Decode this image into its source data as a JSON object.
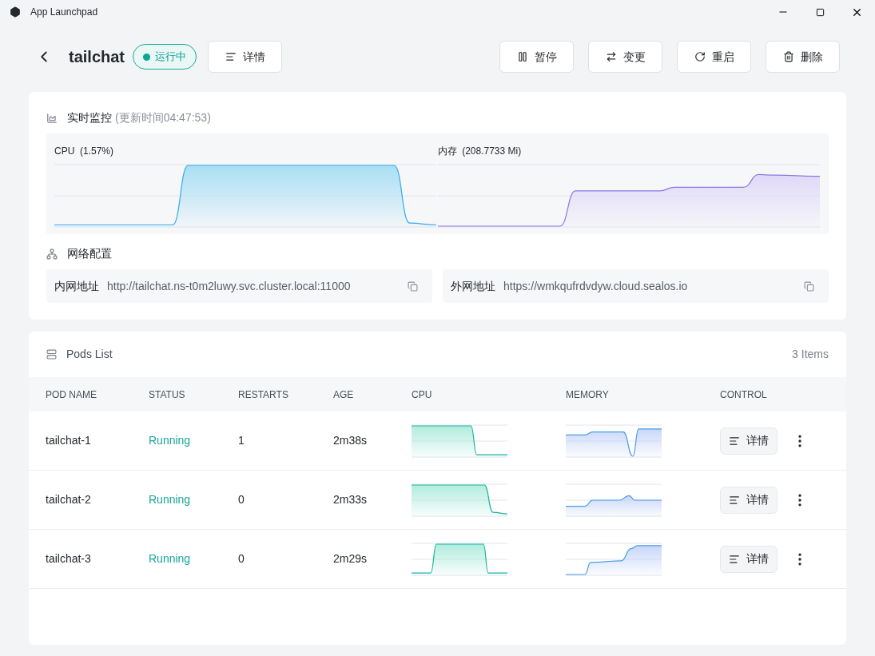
{
  "window": {
    "title": "App Launchpad"
  },
  "header": {
    "app_name": "tailchat",
    "status": "运行中",
    "detail_button": "详情",
    "actions": [
      {
        "kind": "pause",
        "label": "暂停"
      },
      {
        "kind": "change",
        "label": "变更"
      },
      {
        "kind": "restart",
        "label": "重启"
      },
      {
        "kind": "delete",
        "label": "删除"
      }
    ]
  },
  "monitor": {
    "title": "实时监控",
    "updated": "(更新时间04:47:53)",
    "cpu_label": "CPU  (1.57%)",
    "memory_label": "内存  (208.7733 Mi)"
  },
  "network": {
    "title": "网络配置",
    "addresses": [
      {
        "label": "内网地址",
        "url": "http://tailchat.ns-t0m2luwy.svc.cluster.local:11000"
      },
      {
        "label": "外网地址",
        "url": "https://wmkqufrdvdyw.cloud.sealos.io"
      }
    ]
  },
  "pods": {
    "title": "Pods List",
    "count": "3 Items",
    "columns": [
      "POD NAME",
      "STATUS",
      "RESTARTS",
      "AGE",
      "CPU",
      "MEMORY",
      "CONTROL"
    ],
    "rows": [
      {
        "name": "tailchat-1",
        "status": "Running",
        "restarts": "1",
        "age": "2m38s",
        "detail": "详情"
      },
      {
        "name": "tailchat-2",
        "status": "Running",
        "restarts": "0",
        "age": "2m33s",
        "detail": "详情"
      },
      {
        "name": "tailchat-3",
        "status": "Running",
        "restarts": "0",
        "age": "2m29s",
        "detail": "详情"
      }
    ]
  }
}
